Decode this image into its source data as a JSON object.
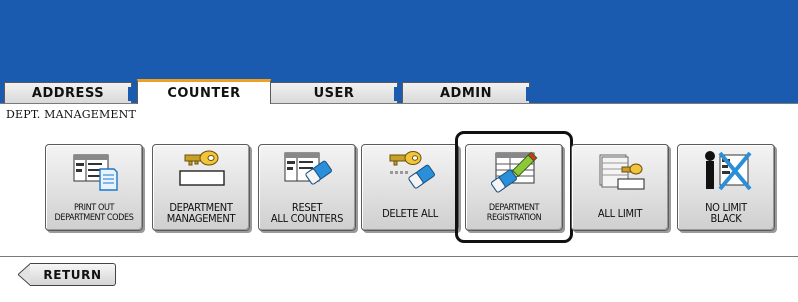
{
  "tabs": [
    {
      "label": "ADDRESS",
      "active": false
    },
    {
      "label": "COUNTER",
      "active": true
    },
    {
      "label": "USER",
      "active": false
    },
    {
      "label": "ADMIN",
      "active": false
    }
  ],
  "page_title": "DEPT. MANAGEMENT",
  "buttons": [
    {
      "label": "PRINT OUT\nDEPARTMENT CODES",
      "icon": "print-list-icon"
    },
    {
      "label": "DEPARTMENT\nMANAGEMENT",
      "icon": "key-password-icon"
    },
    {
      "label": "RESET\nALL COUNTERS",
      "icon": "erase-counters-icon"
    },
    {
      "label": "DELETE ALL",
      "icon": "key-eraser-icon"
    },
    {
      "label": "DEPARTMENT\nREGISTRATION",
      "icon": "edit-register-icon",
      "selected": true
    },
    {
      "label": "ALL LIMIT",
      "icon": "paper-stack-key-icon"
    },
    {
      "label": "NO LIMIT\nBLACK",
      "icon": "no-limit-icon"
    }
  ],
  "footer": {
    "return_label": "RETURN"
  },
  "colors": {
    "header_blue": "#1a5bb0",
    "active_tab_accent": "#f0a020"
  }
}
